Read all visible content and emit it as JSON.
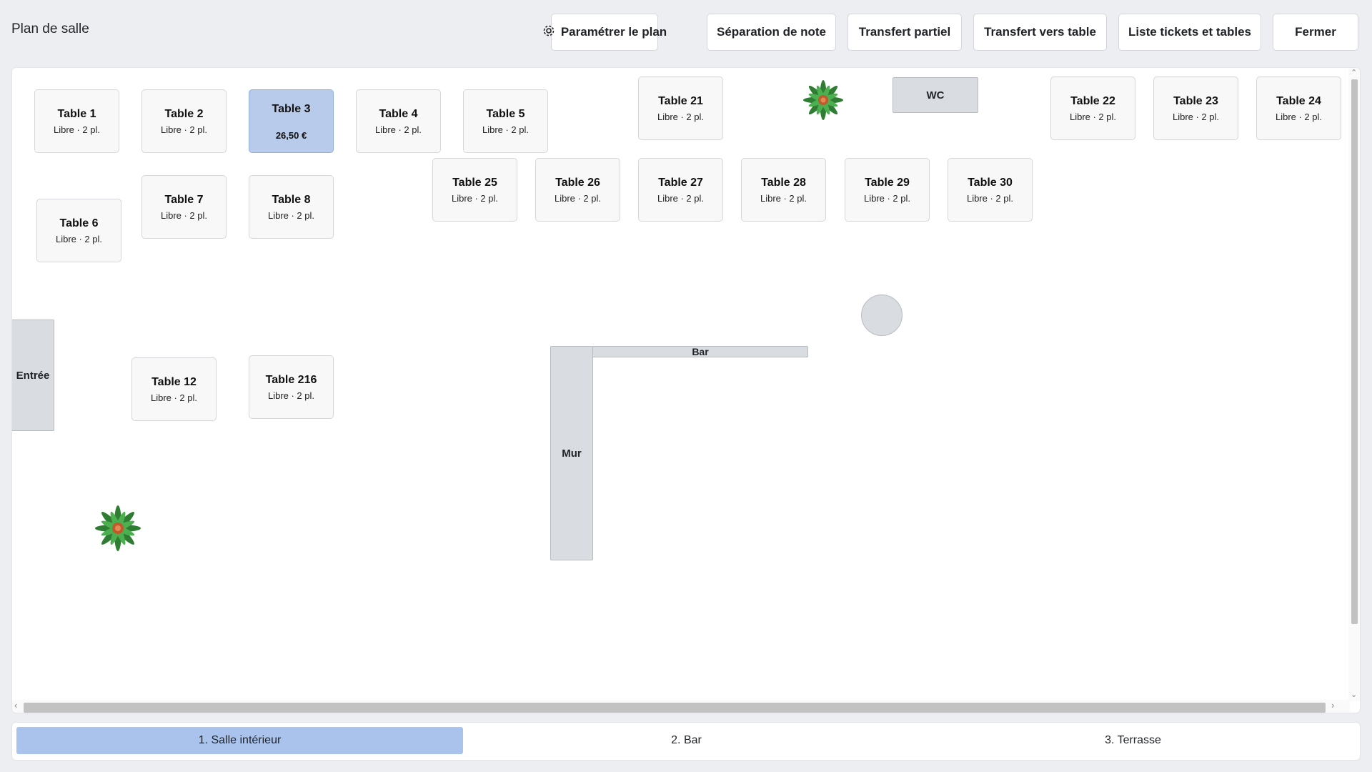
{
  "header": {
    "title": "Plan de salle"
  },
  "toolbar": {
    "settings_label": "Paramétrer le plan",
    "split_note_label": "Séparation de note",
    "partial_transfer_label": "Transfert partiel",
    "transfer_table_label": "Transfert vers table",
    "tickets_list_label": "Liste tickets et tables",
    "close_label": "Fermer",
    "settings_icon": "gear-icon"
  },
  "floor": {
    "tables": [
      {
        "name": "Table 1",
        "status": "Libre · 2 pl."
      },
      {
        "name": "Table 2",
        "status": "Libre · 2 pl."
      },
      {
        "name": "Table 3",
        "amount": "26,50 €",
        "selected": true
      },
      {
        "name": "Table 4",
        "status": "Libre · 2 pl."
      },
      {
        "name": "Table 5",
        "status": "Libre · 2 pl."
      },
      {
        "name": "Table 21",
        "status": "Libre · 2 pl."
      },
      {
        "name": "Table 22",
        "status": "Libre · 2 pl."
      },
      {
        "name": "Table 23",
        "status": "Libre · 2 pl."
      },
      {
        "name": "Table 24",
        "status": "Libre · 2 pl."
      },
      {
        "name": "Table 25",
        "status": "Libre · 2 pl."
      },
      {
        "name": "Table 26",
        "status": "Libre · 2 pl."
      },
      {
        "name": "Table 27",
        "status": "Libre · 2 pl."
      },
      {
        "name": "Table 28",
        "status": "Libre · 2 pl."
      },
      {
        "name": "Table 29",
        "status": "Libre · 2 pl."
      },
      {
        "name": "Table 30",
        "status": "Libre · 2 pl."
      },
      {
        "name": "Table 6",
        "status": "Libre · 2 pl."
      },
      {
        "name": "Table 7",
        "status": "Libre · 2 pl."
      },
      {
        "name": "Table 8",
        "status": "Libre · 2 pl."
      },
      {
        "name": "Table 12",
        "status": "Libre · 2 pl."
      },
      {
        "name": "Table 216",
        "status": "Libre · 2 pl."
      }
    ],
    "fixtures": {
      "wc": "WC",
      "entrance": "Entrée",
      "bar": "Bar",
      "wall": "Mur"
    },
    "decor": [
      "plant-icon",
      "plant-icon",
      "round-pillar"
    ],
    "selected_color": "#b9cbea"
  },
  "rooms": {
    "tabs": [
      {
        "label": "1. Salle intérieur",
        "active": true
      },
      {
        "label": "2. Bar",
        "active": false
      },
      {
        "label": "3. Terrasse",
        "active": false
      }
    ],
    "active_color": "#a9c3ec"
  }
}
